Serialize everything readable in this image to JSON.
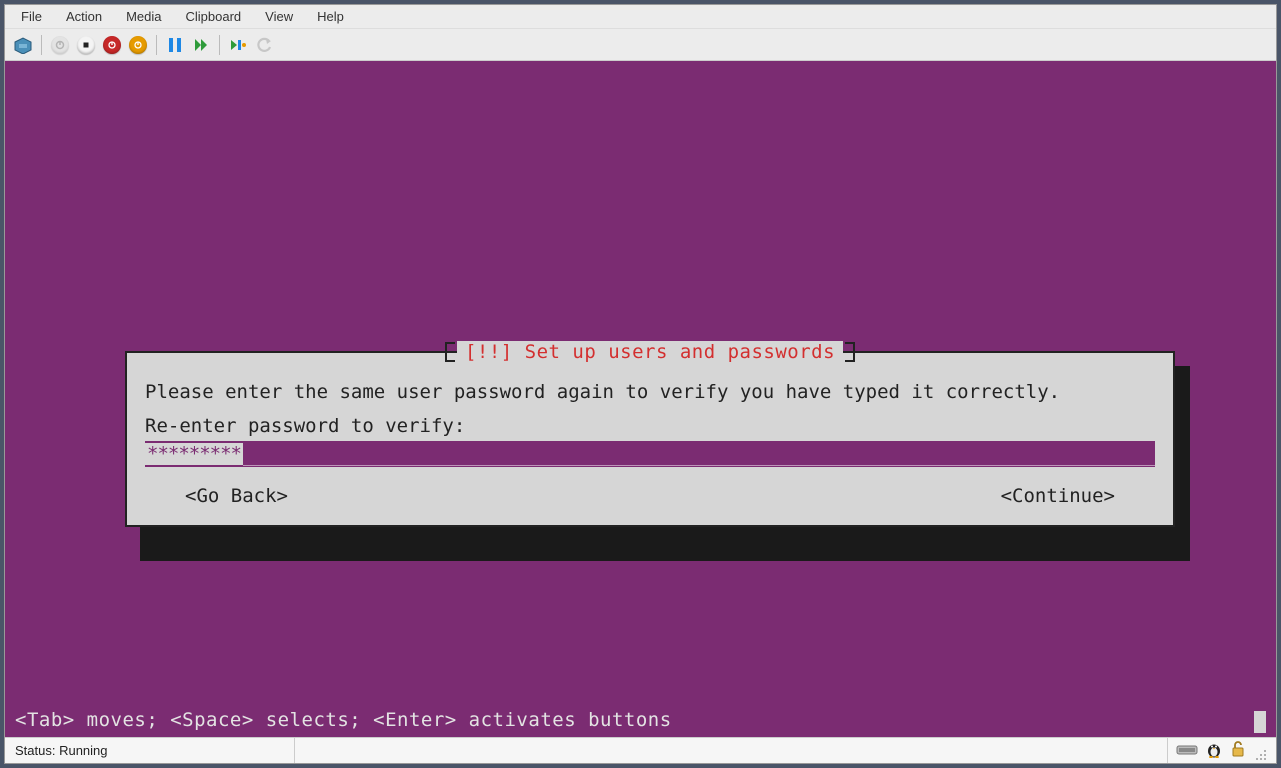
{
  "menu": {
    "file": "File",
    "action": "Action",
    "media": "Media",
    "clipboard": "Clipboard",
    "view": "View",
    "help": "Help"
  },
  "toolbar": {
    "ctrl_alt_del": "ctrl-alt-del",
    "power_off": "power-off",
    "stop": "stop",
    "shutdown": "shutdown",
    "reset": "reset",
    "pause": "pause",
    "play": "play",
    "checkpoint": "checkpoint",
    "revert": "revert"
  },
  "installer": {
    "dialog_title": "[!!] Set up users and passwords",
    "instruction": "Please enter the same user password again to verify you have typed it correctly.",
    "prompt": "Re-enter password to verify:",
    "masked_value": "*********",
    "go_back": "<Go Back>",
    "continue": "<Continue>",
    "hint": "<Tab> moves; <Space> selects; <Enter> activates buttons"
  },
  "status": {
    "label": "Status: Running"
  },
  "colors": {
    "vm_bg": "#7b2c72",
    "dialog_bg": "#d6d6d6",
    "title_fg": "#d32f2f"
  }
}
